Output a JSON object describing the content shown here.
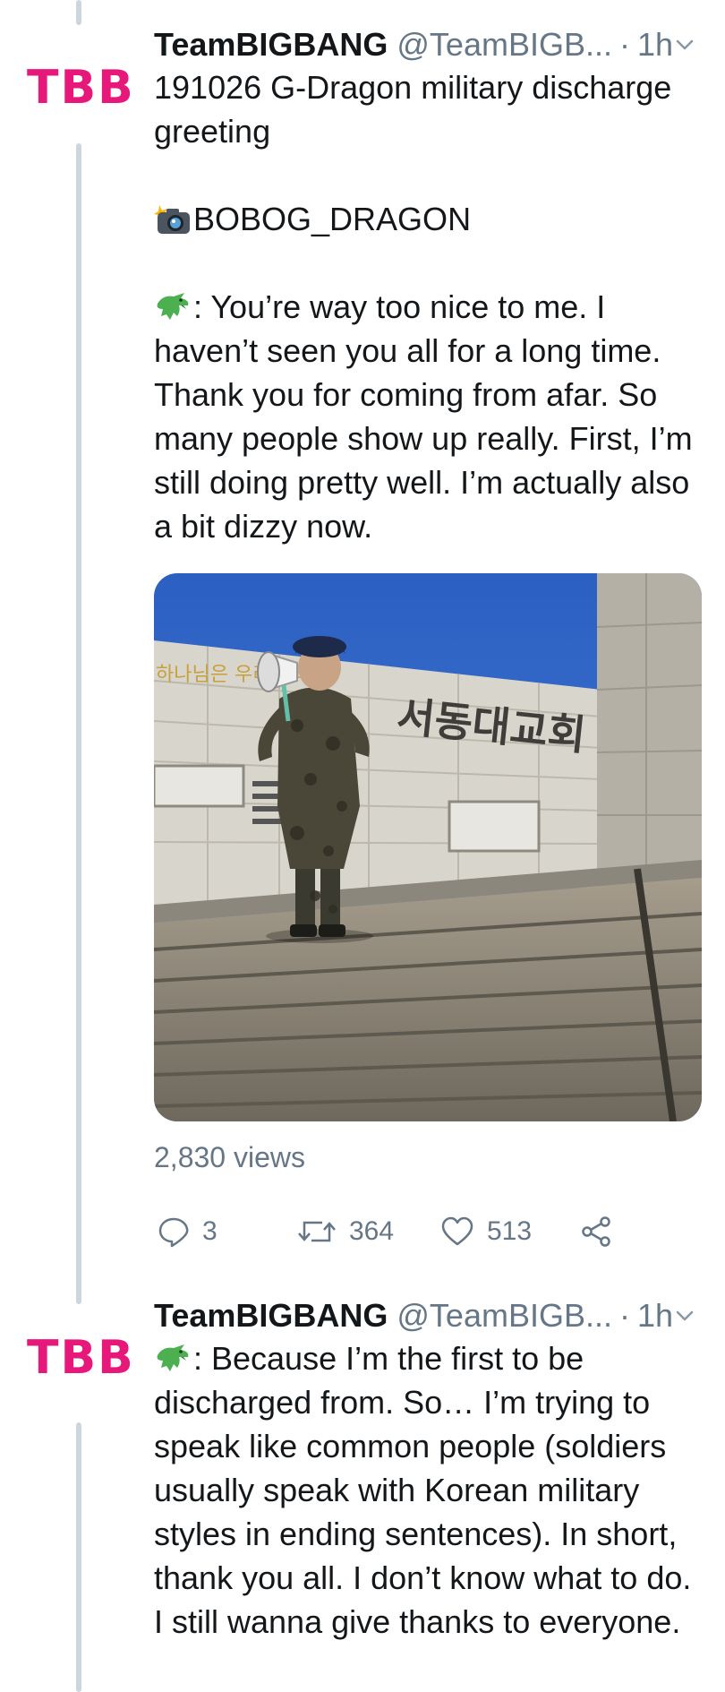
{
  "tweets": [
    {
      "avatar_text": "TBB",
      "name": "TeamBIGBANG",
      "handle": "@TeamBIGB...",
      "separator": "·",
      "time": "1h",
      "lines": [
        "191026 G-Dragon military discharge greeting",
        "BOBOG_DRAGON",
        ": You’re way too nice to me. I haven’t seen you all for a long time. Thank you for coming from afar. So many people show up really. First, I’m still doing pretty well. I’m actually also a bit dizzy now."
      ],
      "media": {
        "sign_text": "서동대교회",
        "window_text": "하나님은 우리 나라를"
      },
      "views": "2,830 views",
      "replies": "3",
      "retweets": "364",
      "likes": "513"
    },
    {
      "avatar_text": "TBB",
      "name": "TeamBIGBANG",
      "handle": "@TeamBIGB...",
      "separator": "·",
      "time": "1h",
      "text": ": Because I’m the first to be discharged from. So… I’m trying to speak like common people (soldiers usually speak with Korean military styles in ending sentences). In short, thank you all. I don’t know what to do. I still wanna give thanks to everyone."
    }
  ],
  "icons": {
    "camera": "camera-flash-icon",
    "dragon": "dragon-icon",
    "reply": "reply-icon",
    "retweet": "retweet-icon",
    "like": "heart-icon",
    "share": "share-icon",
    "menu": "chevron-down-icon"
  },
  "colors": {
    "brand_pink": "#e6187a",
    "text": "#14171a",
    "muted": "#657786",
    "thread_line": "#ccd6dd",
    "sky": "#2f66c6"
  }
}
